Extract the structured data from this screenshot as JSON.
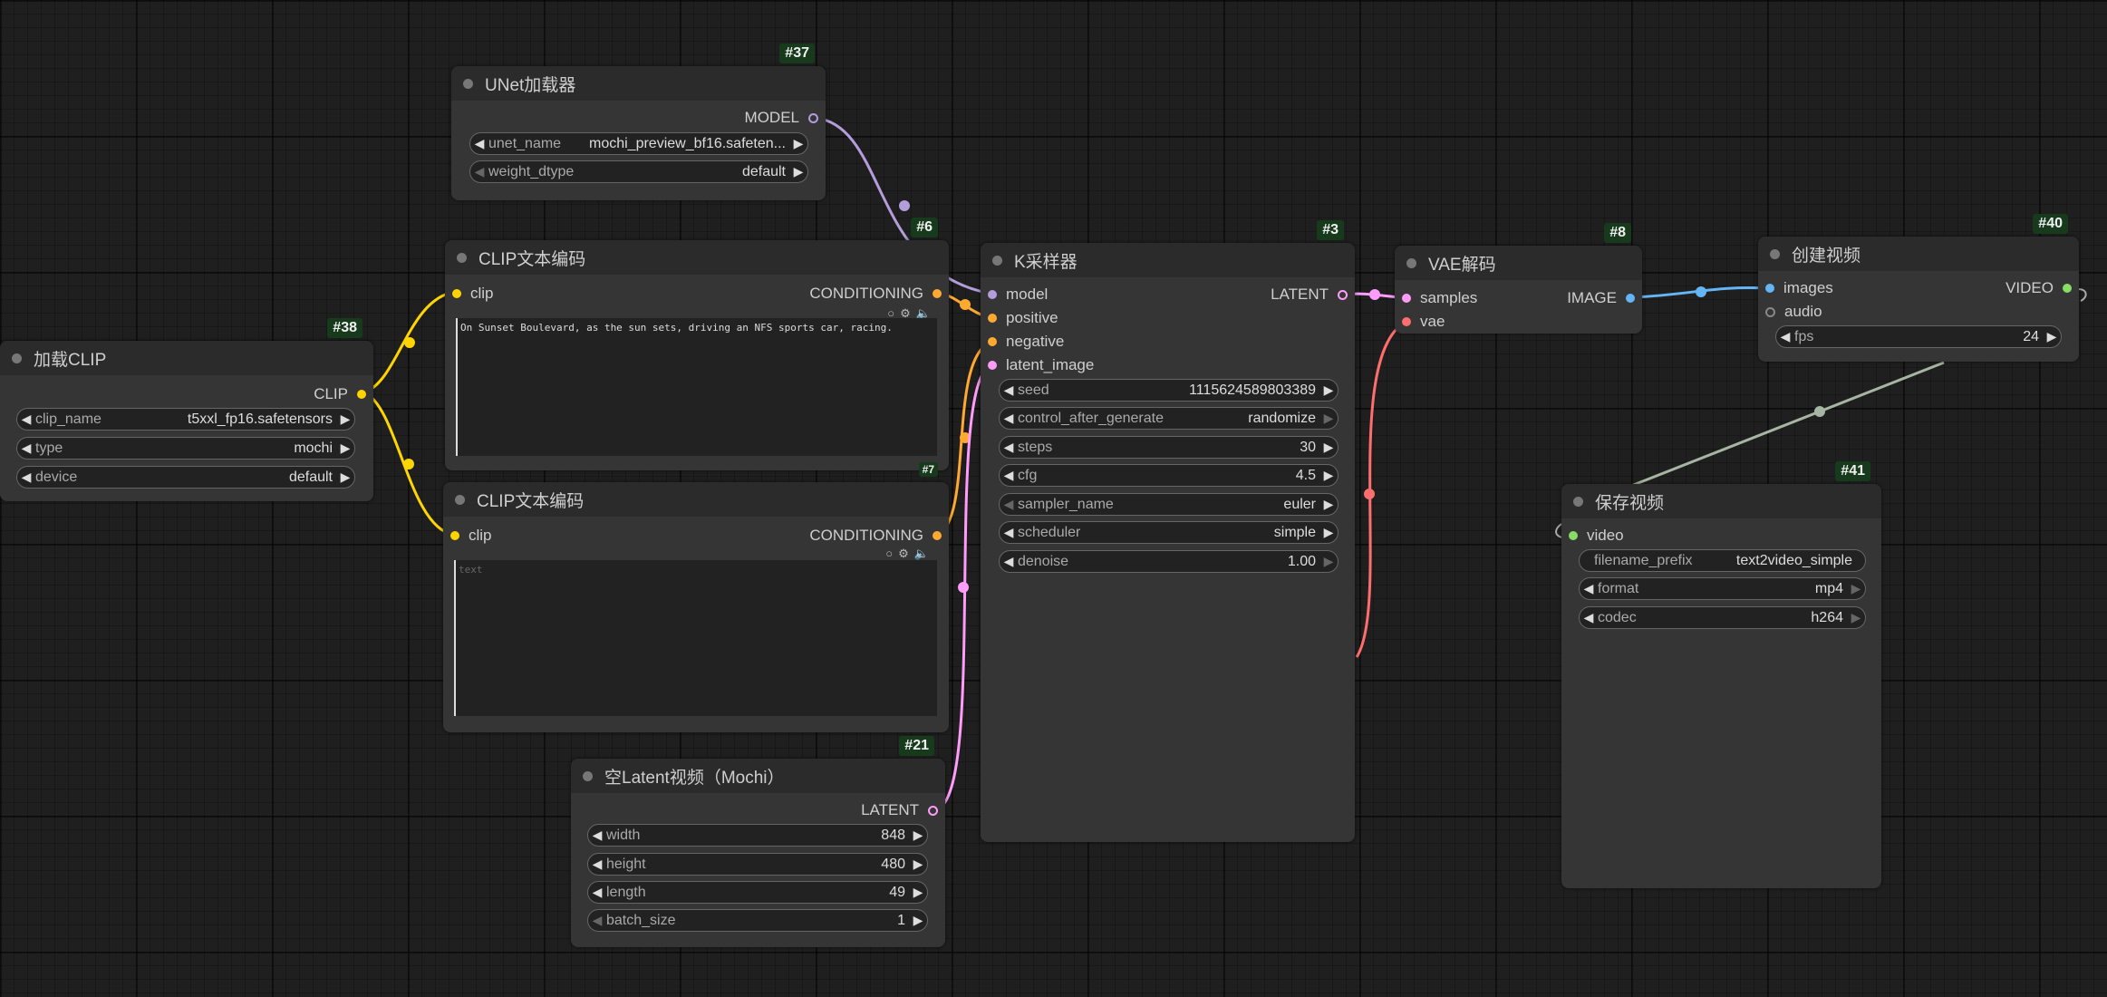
{
  "colors": {
    "clip": "#ffd500",
    "conditioning": "#ffa931",
    "model": "#b39ddb",
    "latent": "#ff9cf9",
    "vae": "#ff6e6e",
    "image": "#64b5f6",
    "video": "#88dd66"
  },
  "nodes": {
    "unet": {
      "id": "#37",
      "title": "UNet加载器",
      "out": "MODEL",
      "unet_name": {
        "name": "unet_name",
        "value": "mochi_preview_bf16.safeten..."
      },
      "weight_dtype": {
        "name": "weight_dtype",
        "value": "default"
      }
    },
    "clip_pos": {
      "id": "#6",
      "title": "CLIP文本编码",
      "in": "clip",
      "out": "CONDITIONING",
      "text": "On Sunset Boulevard, as the sun sets, driving an NFS sports car, racing."
    },
    "clip_neg": {
      "id": "#7",
      "title": "CLIP文本编码",
      "in": "clip",
      "out": "CONDITIONING",
      "placeholder": "text"
    },
    "load_clip": {
      "id": "#38",
      "title": "加载CLIP",
      "out": "CLIP",
      "clip_name": {
        "name": "clip_name",
        "value": "t5xxl_fp16.safetensors"
      },
      "type": {
        "name": "type",
        "value": "mochi"
      },
      "device": {
        "name": "device",
        "value": "default"
      }
    },
    "latent": {
      "id": "#21",
      "title": "空Latent视频（Mochi）",
      "out": "LATENT",
      "width": {
        "name": "width",
        "value": "848"
      },
      "height": {
        "name": "height",
        "value": "480"
      },
      "length": {
        "name": "length",
        "value": "49"
      },
      "batch_size": {
        "name": "batch_size",
        "value": "1"
      }
    },
    "ksampler": {
      "id": "#3",
      "title": "K采样器",
      "out": "LATENT",
      "inputs": {
        "model": "model",
        "positive": "positive",
        "negative": "negative",
        "latent_image": "latent_image"
      },
      "seed": {
        "name": "seed",
        "value": "1115624589803389"
      },
      "control_after_generate": {
        "name": "control_after_generate",
        "value": "randomize"
      },
      "steps": {
        "name": "steps",
        "value": "30"
      },
      "cfg": {
        "name": "cfg",
        "value": "4.5"
      },
      "sampler_name": {
        "name": "sampler_name",
        "value": "euler"
      },
      "scheduler": {
        "name": "scheduler",
        "value": "simple"
      },
      "denoise": {
        "name": "denoise",
        "value": "1.00"
      }
    },
    "vae_decode": {
      "id": "#8",
      "title": "VAE解码",
      "in_samples": "samples",
      "in_vae": "vae",
      "out": "IMAGE"
    },
    "create_video": {
      "id": "#40",
      "title": "创建视频",
      "in_images": "images",
      "in_audio": "audio",
      "out": "VIDEO",
      "fps": {
        "name": "fps",
        "value": "24"
      }
    },
    "save_video": {
      "id": "#41",
      "title": "保存视频",
      "in": "video",
      "filename_prefix": {
        "name": "filename_prefix",
        "value": "text2video_simple"
      },
      "format": {
        "name": "format",
        "value": "mp4"
      },
      "codec": {
        "name": "codec",
        "value": "h264"
      }
    }
  }
}
